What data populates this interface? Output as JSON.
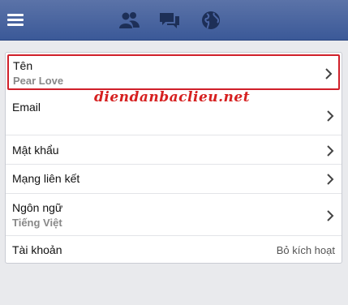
{
  "header": {
    "menu_icon": "menu-icon",
    "icons": [
      "friend-requests-icon",
      "messages-icon",
      "notifications-globe-icon"
    ]
  },
  "settings": {
    "rows": [
      {
        "label": "Tên",
        "value": "Pear Love"
      },
      {
        "label": "Email",
        "value": ""
      },
      {
        "label": "Mật khẩu",
        "value": ""
      },
      {
        "label": "Mạng liên kết",
        "value": ""
      },
      {
        "label": "Ngôn ngữ",
        "value": "Tiếng Việt"
      },
      {
        "label": "Tài khoản",
        "action": "Bỏ kích hoạt"
      }
    ]
  },
  "watermark": "diendanbaclieu.net",
  "colors": {
    "header": "#3b5998",
    "highlight_border": "#d0202a",
    "watermark": "#d62020",
    "background": "#e9eaed"
  }
}
